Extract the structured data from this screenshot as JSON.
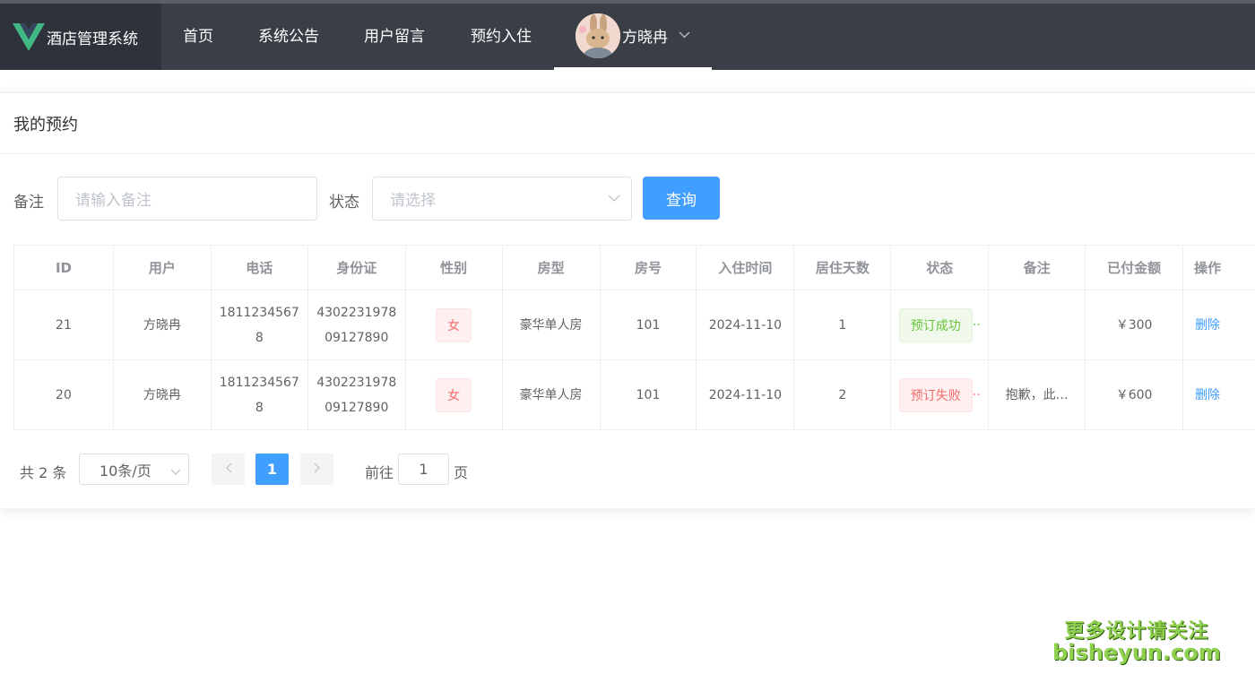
{
  "nav": {
    "app_title": "酒店管理系统",
    "items": [
      {
        "label": "首页"
      },
      {
        "label": "系统公告"
      },
      {
        "label": "用户留言"
      },
      {
        "label": "预约入住"
      }
    ],
    "user_name": "方晓冉"
  },
  "page": {
    "title": "我的预约"
  },
  "filters": {
    "remark_label": "备注",
    "remark_placeholder": "请输入备注",
    "status_label": "状态",
    "status_placeholder": "请选择",
    "query_button": "查询"
  },
  "table": {
    "columns": [
      "ID",
      "用户",
      "电话",
      "身份证",
      "性别",
      "房型",
      "房号",
      "入住时间",
      "居住天数",
      "状态",
      "备注",
      "已付金额",
      "操作"
    ],
    "rows": [
      {
        "id": "21",
        "user": "方晓冉",
        "phone_l1": "1811234567",
        "phone_l2": "8",
        "idcard_l1": "4302231978",
        "idcard_l2": "09127890",
        "gender": "女",
        "room_type": "豪华单人房",
        "room_no": "101",
        "checkin": "2024-11-10",
        "days": "1",
        "status": "预订成功",
        "remark": "",
        "paid": "￥300",
        "action": "删除"
      },
      {
        "id": "20",
        "user": "方晓冉",
        "phone_l1": "1811234567",
        "phone_l2": "8",
        "idcard_l1": "4302231978",
        "idcard_l2": "09127890",
        "gender": "女",
        "room_type": "豪华单人房",
        "room_no": "101",
        "checkin": "2024-11-10",
        "days": "2",
        "status": "预订失败",
        "remark": "抱歉，此…",
        "paid": "￥600",
        "action": "删除"
      }
    ]
  },
  "pagination": {
    "total": "共 2 条",
    "page_size": "10条/页",
    "current": "1",
    "goto_label": "前往",
    "goto_value": "1",
    "page_unit": "页"
  },
  "watermark": {
    "line1": "更多设计请关注",
    "line2": "bisheyun.com"
  },
  "colors": {
    "nav_bg": "#3a3f47",
    "primary": "#409eff",
    "success": "#67c23a",
    "danger": "#f56c6c"
  }
}
